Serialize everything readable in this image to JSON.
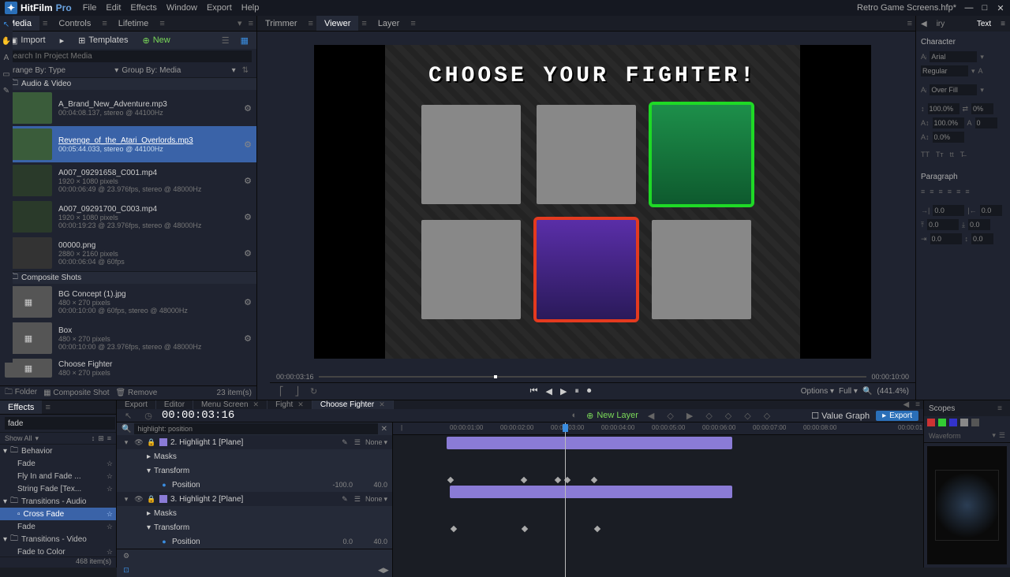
{
  "app": {
    "name": "HitFilm",
    "suffix": "Pro",
    "project": "Retro Game Screens.hfp*"
  },
  "menubar": [
    "File",
    "Edit",
    "Effects",
    "Window",
    "Export",
    "Help"
  ],
  "mediaPanel": {
    "tabs": [
      "Media",
      "Controls",
      "Lifetime"
    ],
    "activeTab": 0,
    "import": "Import",
    "templates": "Templates",
    "new": "New",
    "searchPlaceholder": "Search In Project Media",
    "arrangeLabel": "Arrange By:",
    "arrangeValue": "Type",
    "groupLabel": "Group By:",
    "groupValue": "Media",
    "sections": {
      "av": "Audio & Video",
      "comp": "Composite Shots"
    },
    "items": [
      {
        "name": "A_Brand_New_Adventure.mp3",
        "meta": "00:04:08.137, stereo @ 44100Hz",
        "type": "audio"
      },
      {
        "name": "Revenge_of_the_Atari_Overlords.mp3",
        "meta": "00:05:44.033, stereo @ 44100Hz",
        "type": "audio",
        "selected": true
      },
      {
        "name": "A007_09291658_C001.mp4",
        "meta": "1920 × 1080 pixels",
        "meta2": "00:00:06:49 @ 23.976fps, stereo @ 48000Hz",
        "type": "video"
      },
      {
        "name": "A007_09291700_C003.mp4",
        "meta": "1920 × 1080 pixels",
        "meta2": "00:00:19:23 @ 23.976fps, stereo @ 48000Hz",
        "type": "video"
      },
      {
        "name": "00000.png",
        "meta": "2880 × 2160 pixels",
        "meta2": "00:00:06:04 @ 60fps",
        "type": "img"
      }
    ],
    "compItems": [
      {
        "name": "BG Concept (1).jpg",
        "meta": "480 × 270 pixels",
        "meta2": "00:00:10:00 @ 60fps, stereo @ 48000Hz"
      },
      {
        "name": "Box",
        "meta": "480 × 270 pixels",
        "meta2": "00:00:10:00 @ 23.976fps, stereo @ 48000Hz"
      },
      {
        "name": "Choose Fighter",
        "meta": "480 × 270 pixels"
      }
    ],
    "footer": {
      "folder": "Folder",
      "compShot": "Composite Shot",
      "remove": "Remove",
      "count": "23 item(s)"
    }
  },
  "viewer": {
    "tabs": [
      "Trimmer",
      "Viewer",
      "Layer"
    ],
    "activeTab": 1,
    "title": "CHOOSE YOUR FIGHTER!",
    "timeLeft": "00:00:03:16",
    "timeRight": "00:00:10:00",
    "options": "Options",
    "full": "Full",
    "zoom": "(441.4%)"
  },
  "textPanel": {
    "tabsLeft": "iry",
    "tabsRight": "Text",
    "character": "Character",
    "font": "Arial",
    "weight": "Regular",
    "overfill": "Over Fill",
    "pct100": "100.0%",
    "pctA": "0.0%",
    "zero": "0",
    "zeroPct": "0%",
    "paragraph": "Paragraph",
    "val0": "0.0"
  },
  "effectsPanel": {
    "tab": "Effects",
    "search": "fade",
    "showAll": "Show All",
    "tree": [
      {
        "label": "Behavior",
        "kind": "folder"
      },
      {
        "label": "Fade",
        "kind": "item"
      },
      {
        "label": "Fly In and Fade ...",
        "kind": "item"
      },
      {
        "label": "String Fade [Tex...",
        "kind": "item"
      },
      {
        "label": "Transitions - Audio",
        "kind": "folder"
      },
      {
        "label": "Cross Fade",
        "kind": "item",
        "selected": true
      },
      {
        "label": "Fade",
        "kind": "item"
      },
      {
        "label": "Transitions - Video",
        "kind": "folder"
      },
      {
        "label": "Fade to Color",
        "kind": "item"
      }
    ],
    "count": "468 item(s)"
  },
  "timeline": {
    "tabs": [
      {
        "label": "Export"
      },
      {
        "label": "Editor"
      },
      {
        "label": "Menu Screen",
        "closable": true
      },
      {
        "label": "Fight",
        "closable": true
      },
      {
        "label": "Choose Fighter",
        "closable": true,
        "active": true
      }
    ],
    "timecode": "00:00:03:16",
    "newLayer": "New Layer",
    "valueGraph": "Value Graph",
    "export": "Export",
    "filterPlaceholder": "highlight: position",
    "ruler": [
      "00:00:01:00",
      "00:00:02:00",
      "00:00:03:00",
      "00:00:04:00",
      "00:00:05:00",
      "00:00:06:00",
      "00:00:07:00",
      "00:00:08:00",
      "00:00:01"
    ],
    "layers": [
      {
        "idx": "2.",
        "name": "Highlight 1 [Plane]",
        "blend": "None"
      },
      {
        "idx": "3.",
        "name": "Highlight 2 [Plane]",
        "blend": "None"
      }
    ],
    "props": {
      "masks": "Masks",
      "transform": "Transform",
      "position": "Position"
    },
    "vals": {
      "l1px": "-100.0",
      "l1py": "40.0",
      "l2px": "0.0",
      "l2py": "40.0"
    }
  },
  "scopes": {
    "tab": "Scopes",
    "waveform": "Waveform"
  }
}
